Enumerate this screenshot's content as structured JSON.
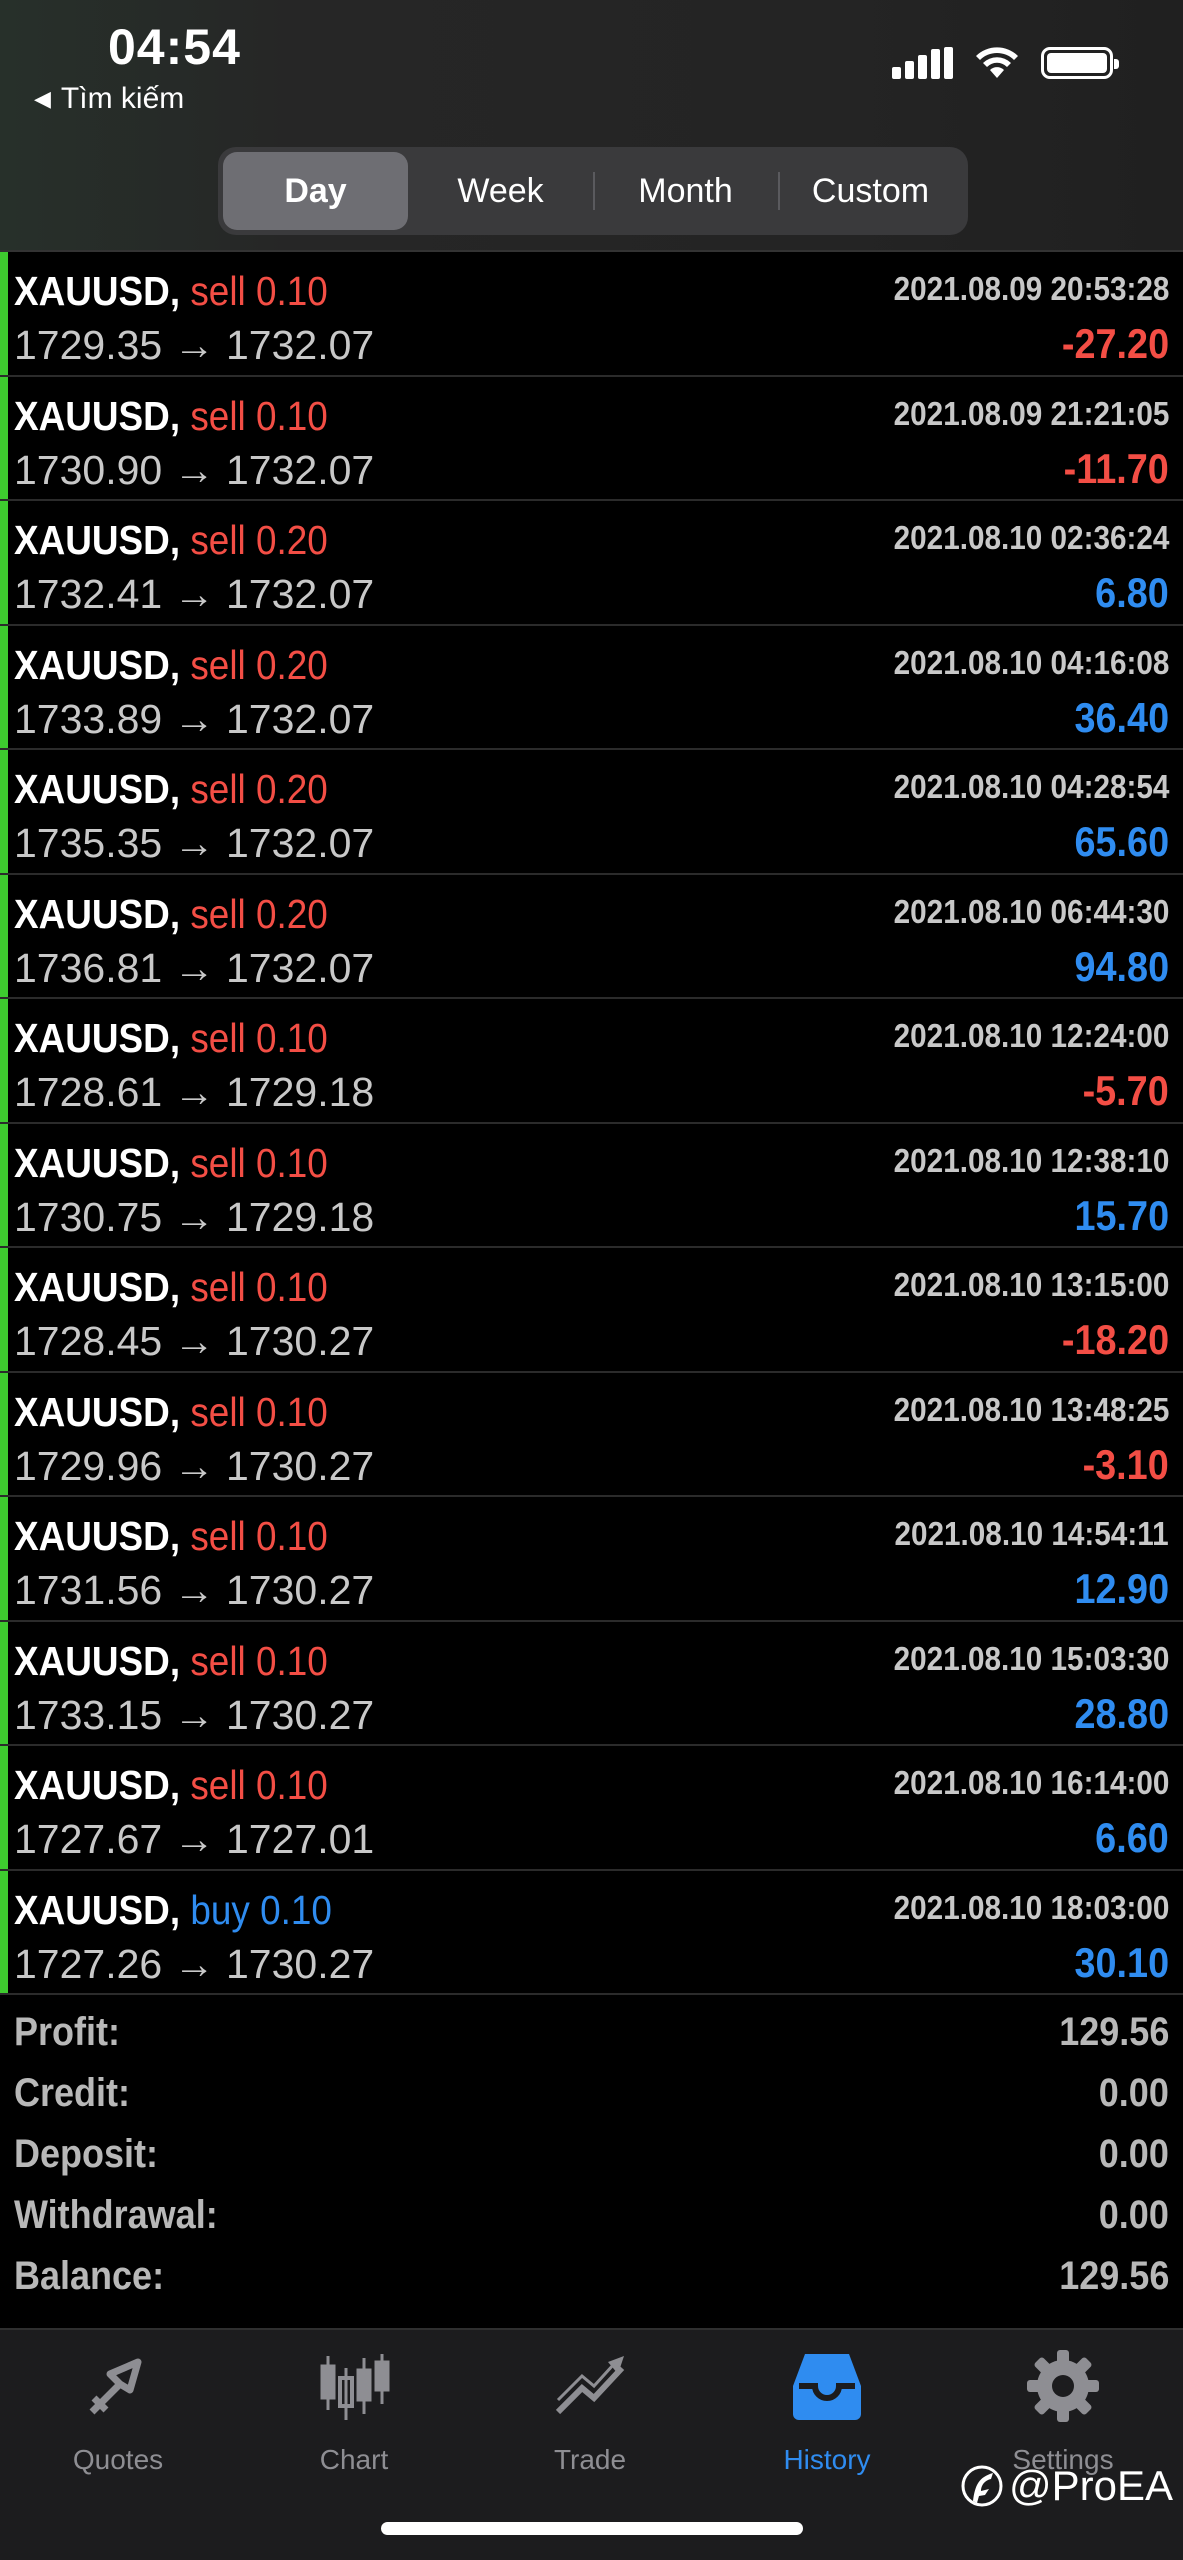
{
  "status_bar": {
    "time": "04:54",
    "back_label": "Tìm kiếm"
  },
  "period_tabs": [
    "Day",
    "Week",
    "Month",
    "Custom"
  ],
  "active_period": "Day",
  "trades": [
    {
      "symbol": "XAUUSD,",
      "side": "sell",
      "volume": "0.10",
      "prices": "1729.35 → 1732.07",
      "time": "2021.08.09 20:53:28",
      "profit": "-27.20"
    },
    {
      "symbol": "XAUUSD,",
      "side": "sell",
      "volume": "0.10",
      "prices": "1730.90 → 1732.07",
      "time": "2021.08.09 21:21:05",
      "profit": "-11.70"
    },
    {
      "symbol": "XAUUSD,",
      "side": "sell",
      "volume": "0.20",
      "prices": "1732.41 → 1732.07",
      "time": "2021.08.10 02:36:24",
      "profit": "6.80"
    },
    {
      "symbol": "XAUUSD,",
      "side": "sell",
      "volume": "0.20",
      "prices": "1733.89 → 1732.07",
      "time": "2021.08.10 04:16:08",
      "profit": "36.40"
    },
    {
      "symbol": "XAUUSD,",
      "side": "sell",
      "volume": "0.20",
      "prices": "1735.35 → 1732.07",
      "time": "2021.08.10 04:28:54",
      "profit": "65.60"
    },
    {
      "symbol": "XAUUSD,",
      "side": "sell",
      "volume": "0.20",
      "prices": "1736.81 → 1732.07",
      "time": "2021.08.10 06:44:30",
      "profit": "94.80"
    },
    {
      "symbol": "XAUUSD,",
      "side": "sell",
      "volume": "0.10",
      "prices": "1728.61 → 1729.18",
      "time": "2021.08.10 12:24:00",
      "profit": "-5.70"
    },
    {
      "symbol": "XAUUSD,",
      "side": "sell",
      "volume": "0.10",
      "prices": "1730.75 → 1729.18",
      "time": "2021.08.10 12:38:10",
      "profit": "15.70"
    },
    {
      "symbol": "XAUUSD,",
      "side": "sell",
      "volume": "0.10",
      "prices": "1728.45 → 1730.27",
      "time": "2021.08.10 13:15:00",
      "profit": "-18.20"
    },
    {
      "symbol": "XAUUSD,",
      "side": "sell",
      "volume": "0.10",
      "prices": "1729.96 → 1730.27",
      "time": "2021.08.10 13:48:25",
      "profit": "-3.10"
    },
    {
      "symbol": "XAUUSD,",
      "side": "sell",
      "volume": "0.10",
      "prices": "1731.56 → 1730.27",
      "time": "2021.08.10 14:54:11",
      "profit": "12.90"
    },
    {
      "symbol": "XAUUSD,",
      "side": "sell",
      "volume": "0.10",
      "prices": "1733.15 → 1730.27",
      "time": "2021.08.10 15:03:30",
      "profit": "28.80"
    },
    {
      "symbol": "XAUUSD,",
      "side": "sell",
      "volume": "0.10",
      "prices": "1727.67 → 1727.01",
      "time": "2021.08.10 16:14:00",
      "profit": "6.60"
    },
    {
      "symbol": "XAUUSD,",
      "side": "buy",
      "volume": "0.10",
      "prices": "1727.26 → 1730.27",
      "time": "2021.08.10 18:03:00",
      "profit": "30.10"
    }
  ],
  "summary": [
    {
      "label": "Profit:",
      "value": "129.56"
    },
    {
      "label": "Credit:",
      "value": "0.00"
    },
    {
      "label": "Deposit:",
      "value": "0.00"
    },
    {
      "label": "Withdrawal:",
      "value": "0.00"
    },
    {
      "label": "Balance:",
      "value": "129.56"
    }
  ],
  "tabbar": [
    {
      "label": "Quotes",
      "icon": "quotes-icon"
    },
    {
      "label": "Chart",
      "icon": "chart-icon"
    },
    {
      "label": "Trade",
      "icon": "trade-icon"
    },
    {
      "label": "History",
      "icon": "history-icon"
    },
    {
      "label": "Settings",
      "icon": "settings-icon"
    }
  ],
  "active_tab": "History",
  "watermark": "@ProEA",
  "colors": {
    "sell": "#f34e45",
    "buy": "#2f8cf0",
    "loss": "#f34e45",
    "gain": "#2f8cf0",
    "accent_bar": "#3ecb2f",
    "active_tab": "#2f8cf0"
  }
}
